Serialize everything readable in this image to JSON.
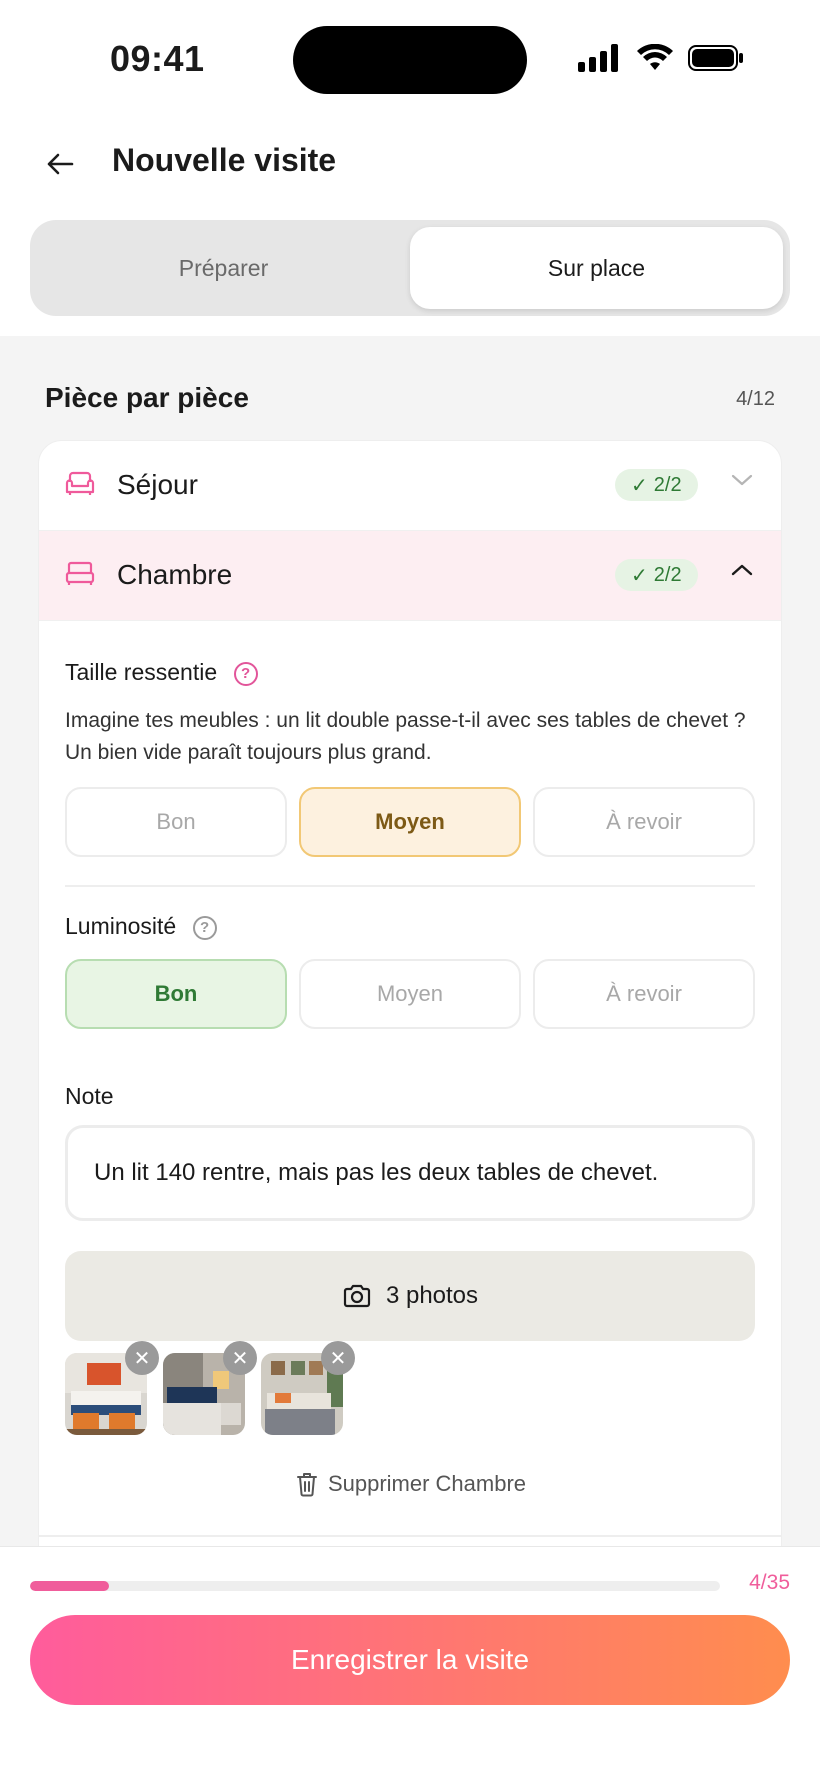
{
  "status_bar": {
    "time": "09:41"
  },
  "header": {
    "title": "Nouvelle visite"
  },
  "tabs": [
    {
      "label": "Préparer",
      "active": false
    },
    {
      "label": "Sur place",
      "active": true
    }
  ],
  "section": {
    "title": "Pièce par pièce",
    "count": "4/12"
  },
  "rooms": [
    {
      "name": "Séjour",
      "icon": "sofa-icon",
      "badge": "2/2",
      "expanded": false
    },
    {
      "name": "Chambre",
      "icon": "bed-icon",
      "badge": "2/2",
      "expanded": true
    }
  ],
  "criteria": {
    "size": {
      "label": "Taille ressentie",
      "description": "Imagine tes meubles : un lit double passe-t-il avec ses tables de chevet ? Un bien vide paraît toujours plus grand.",
      "options": [
        "Bon",
        "Moyen",
        "À revoir"
      ],
      "selected": "Moyen"
    },
    "light": {
      "label": "Luminosité",
      "options": [
        "Bon",
        "Moyen",
        "À revoir"
      ],
      "selected": "Bon"
    }
  },
  "note": {
    "label": "Note",
    "value": "Un lit 140 rentre, mais pas les deux tables de chevet."
  },
  "photos": {
    "button_label": "3 photos",
    "count": 3
  },
  "delete_label": "Supprimer Chambre",
  "progress": {
    "label": "4/35",
    "fraction": 0.114
  },
  "save_button": "Enregistrer la visite",
  "colors": {
    "accent": "#f05d9b",
    "gradient_end": "#ff8d4e",
    "good": "#2f7a35",
    "medium": "#7d5a16"
  }
}
